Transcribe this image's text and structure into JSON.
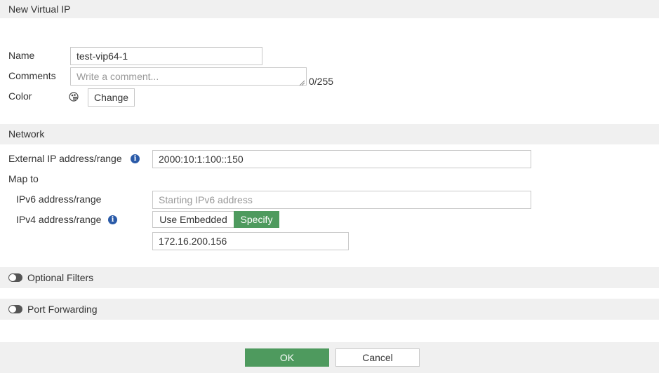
{
  "dialog": {
    "title": "New Virtual IP"
  },
  "general": {
    "name_label": "Name",
    "name_value": "test-vip64-1",
    "comments_label": "Comments",
    "comments_placeholder": "Write a comment...",
    "comments_counter": "0/255",
    "color_label": "Color",
    "color_change_button": "Change"
  },
  "network": {
    "section_title": "Network",
    "external_ip_label": "External IP address/range",
    "external_ip_value": "2000:10:1:100::150",
    "map_to_label": "Map to",
    "ipv6_label": "IPv6 address/range",
    "ipv6_placeholder": "Starting IPv6 address",
    "ipv4_label": "IPv4 address/range",
    "ipv4_option_embedded": "Use Embedded",
    "ipv4_option_specify": "Specify",
    "ipv4_selected": "Specify",
    "ipv4_value": "172.16.200.156"
  },
  "optional_filters": {
    "label": "Optional Filters",
    "enabled": false
  },
  "port_forwarding": {
    "label": "Port Forwarding",
    "enabled": false
  },
  "footer": {
    "ok_label": "OK",
    "cancel_label": "Cancel"
  },
  "colors": {
    "accent_green": "#4e9a5e",
    "info_blue": "#2a5aa8",
    "section_bg": "#f0f0f0"
  },
  "icons": {
    "info": "info-icon",
    "color_swatch": "palette-icon",
    "toggle": "toggle-switch"
  }
}
